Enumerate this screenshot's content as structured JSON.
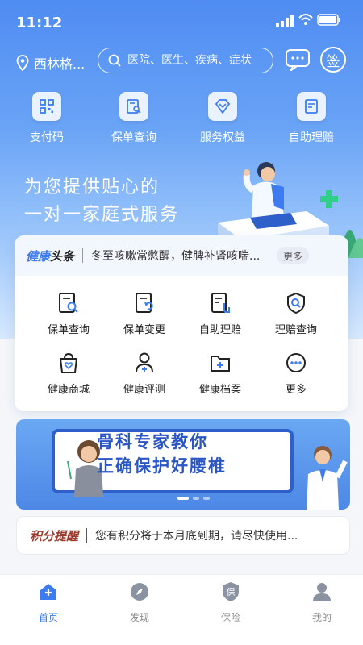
{
  "status_bar": {
    "time": "11:12"
  },
  "top_bar": {
    "location": "西林格...",
    "search_placeholder": "医院、医生、疾病、症状",
    "sign_label": "签"
  },
  "quick_actions": [
    {
      "label": "支付码",
      "icon": "qr-code-icon"
    },
    {
      "label": "保单查询",
      "icon": "policy-search-icon"
    },
    {
      "label": "服务权益",
      "icon": "diamond-icon"
    },
    {
      "label": "自助理赔",
      "icon": "self-claim-icon"
    }
  ],
  "slogan": {
    "line1": "为您提供贴心的",
    "line2": "一对一家庭式服务"
  },
  "health_news": {
    "brand_part1": "健康",
    "brand_part2": "头条",
    "text": "冬至咳嗽常憋醒，健脾补肾咳喘...",
    "more_label": "更多"
  },
  "services": [
    {
      "label": "保单查询",
      "icon": "policy-search-icon"
    },
    {
      "label": "保单变更",
      "icon": "policy-change-icon"
    },
    {
      "label": "自助理赔",
      "icon": "self-claim-icon"
    },
    {
      "label": "理赔查询",
      "icon": "claim-query-icon"
    },
    {
      "label": "健康商城",
      "icon": "shopping-bag-icon"
    },
    {
      "label": "健康评测",
      "icon": "doctor-icon"
    },
    {
      "label": "健康档案",
      "icon": "folder-icon"
    },
    {
      "label": "更多",
      "icon": "more-icon"
    }
  ],
  "banner": {
    "line1": "骨科专家教你",
    "line2": "正确保护好腰椎"
  },
  "points_notice": {
    "brand": "积分提醒",
    "text": "您有积分将于本月底到期，请尽快使用..."
  },
  "tabs": [
    {
      "label": "首页",
      "icon": "home-icon",
      "active": true
    },
    {
      "label": "发现",
      "icon": "compass-icon",
      "active": false
    },
    {
      "label": "保险",
      "icon": "insurance-shield-icon",
      "active": false
    },
    {
      "label": "我的",
      "icon": "person-icon",
      "active": false
    }
  ],
  "colors": {
    "accent": "#3d7cf0",
    "hero_top": "#4f8cf2",
    "points_brand": "#9a3b2e"
  }
}
